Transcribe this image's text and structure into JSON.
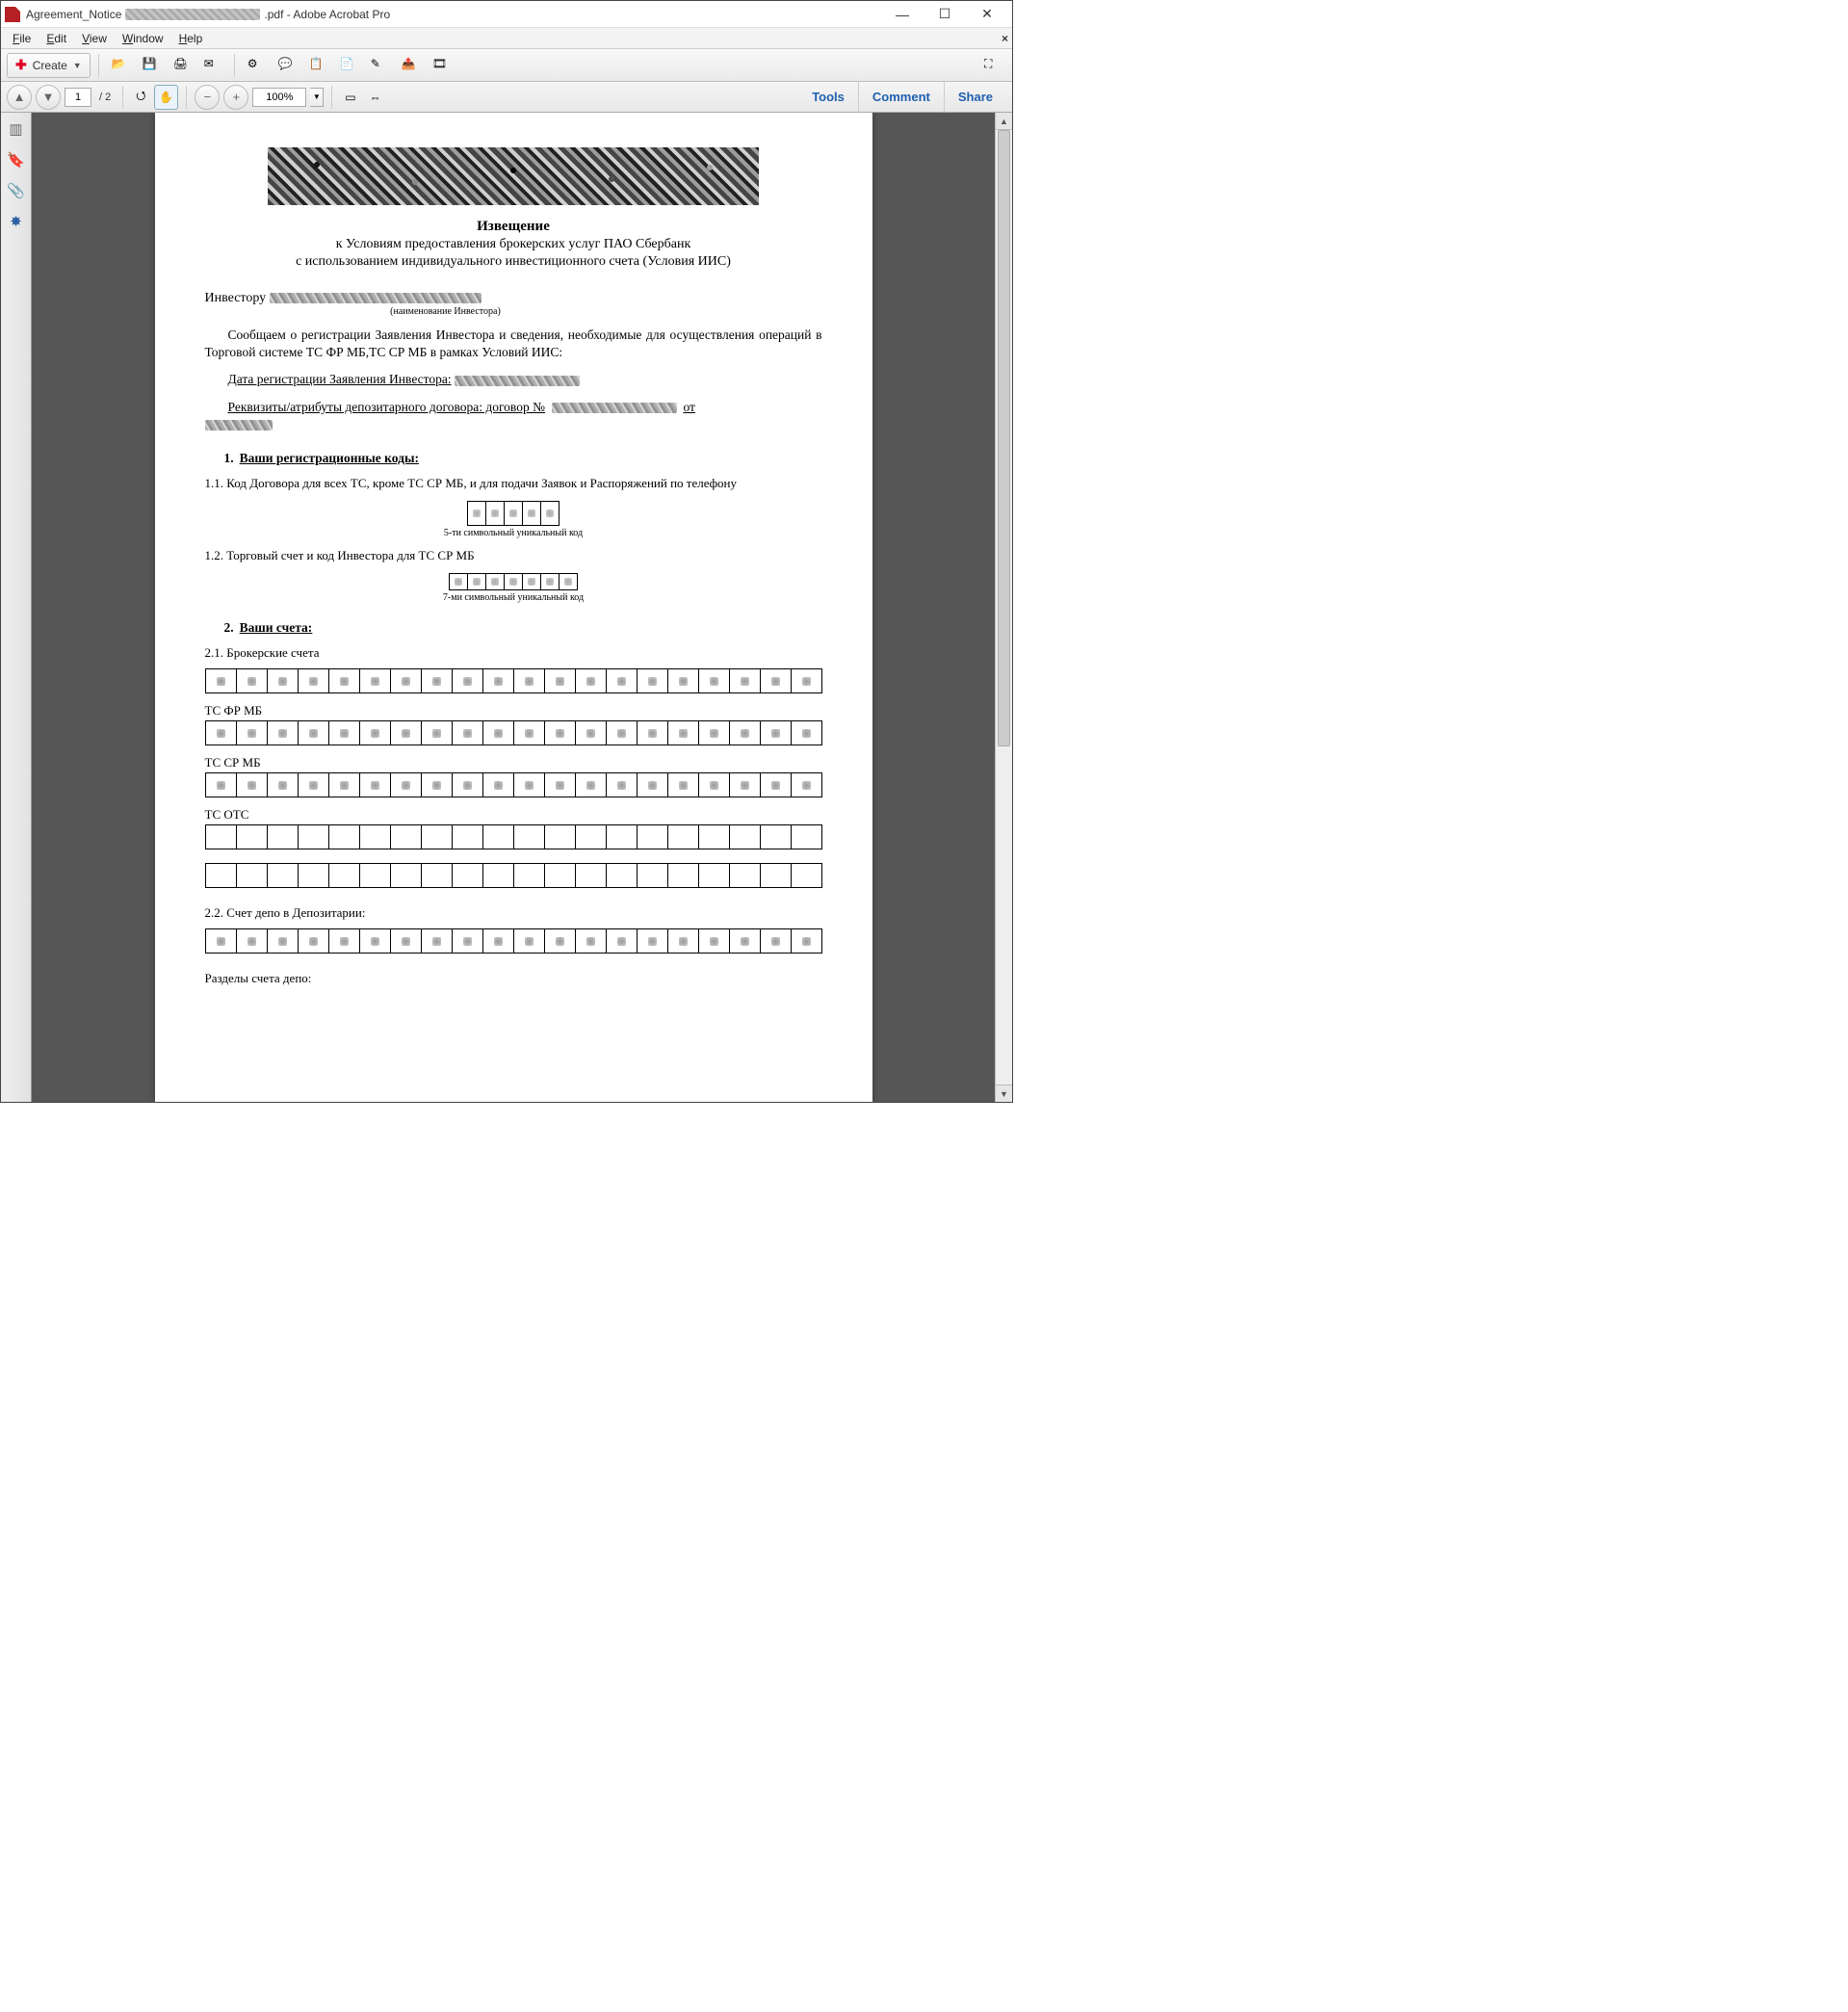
{
  "window": {
    "title_prefix": "Agreement_Notice",
    "title_suffix": ".pdf - Adobe Acrobat Pro"
  },
  "menu": {
    "file": "File",
    "edit": "Edit",
    "view": "View",
    "window": "Window",
    "help": "Help"
  },
  "toolbar": {
    "create": "Create"
  },
  "nav": {
    "page_current": "1",
    "page_total": "/ 2",
    "zoom": "100%"
  },
  "right": {
    "tools": "Tools",
    "comment": "Comment",
    "share": "Share"
  },
  "doc": {
    "title": "Извещение",
    "sub1": "к Условиям предоставления брокерских услуг ПАО Сбербанк",
    "sub2": "с использованием индивидуального инвестиционного счета (Условия ИИС)",
    "investor_label": "Инвестору",
    "investor_note": "(наименование Инвестора)",
    "intro": "Сообщаем о регистрации Заявления Инвестора и сведения, необходимые для осуществления операций в Торговой системе ТС ФР МБ,ТС СР МБ в рамках Условий ИИС:",
    "date_line": "Дата регистрации Заявления Инвестора:",
    "req_line_a": "Реквизиты/атрибуты депозитарного договора: договор №",
    "req_line_b": "от",
    "sec1": "Ваши регистрационные коды:",
    "p11": "1.1. Код Договора для всех ТС, кроме ТС СР МБ, и для подачи Заявок и Распоряжений по телефону",
    "cap5": "5-ти символьный уникальный код",
    "p12": "1.2. Торговый счет и код Инвестора для ТС СР МБ",
    "cap7": "7-ми символьный уникальный код",
    "sec2": "Ваши счета:",
    "p21": "2.1. Брокерские счета",
    "l_fr": "ТС ФР МБ",
    "l_sr": "ТС СР МБ",
    "l_otc": "ТС ОТС",
    "p22": "2.2. Счет депо в Депозитарии:",
    "p_sec": "Разделы счета депо:"
  }
}
